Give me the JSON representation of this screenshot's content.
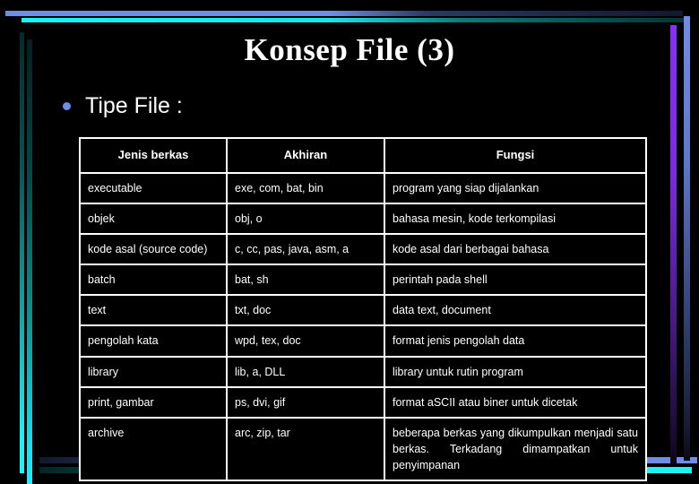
{
  "slide": {
    "title": "Konsep File (3)",
    "bullet": {
      "icon": "bullet-dot-icon",
      "text": "Tipe File :"
    }
  },
  "colors": {
    "background": "#000000",
    "text": "#ffffff",
    "bullet": "#6f8de8",
    "accent_cyan": "#1ef2f2",
    "accent_blue": "#6f8de8",
    "accent_purple": "#8a2ff5",
    "table_border": "#ffffff"
  },
  "table": {
    "headers": [
      "Jenis berkas",
      "Akhiran",
      "Fungsi"
    ],
    "rows": [
      {
        "jenis": "executable",
        "akhiran": "exe, com, bat, bin",
        "fungsi": "program yang siap dijalankan"
      },
      {
        "jenis": "objek",
        "akhiran": "obj, o",
        "fungsi": "bahasa mesin, kode terkompilasi"
      },
      {
        "jenis": "kode asal (source code)",
        "akhiran": "c, cc, pas, java, asm, a",
        "fungsi": "kode asal dari berbagai bahasa"
      },
      {
        "jenis": "batch",
        "akhiran": "bat, sh",
        "fungsi": "perintah pada shell"
      },
      {
        "jenis": "text",
        "akhiran": "txt, doc",
        "fungsi": "data text, document"
      },
      {
        "jenis": "pengolah kata",
        "akhiran": "wpd, tex, doc",
        "fungsi": "format jenis pengolah data"
      },
      {
        "jenis": "library",
        "akhiran": "lib, a, DLL",
        "fungsi": "library untuk rutin program"
      },
      {
        "jenis": "print, gambar",
        "akhiran": "ps, dvi, gif",
        "fungsi": "format aSCII atau biner untuk dicetak"
      },
      {
        "jenis": "archive",
        "akhiran": "arc, zip, tar",
        "fungsi": "beberapa berkas yang dikumpulkan menjadi satu berkas. Terkadang dimampatkan untuk penyimpanan"
      }
    ]
  }
}
